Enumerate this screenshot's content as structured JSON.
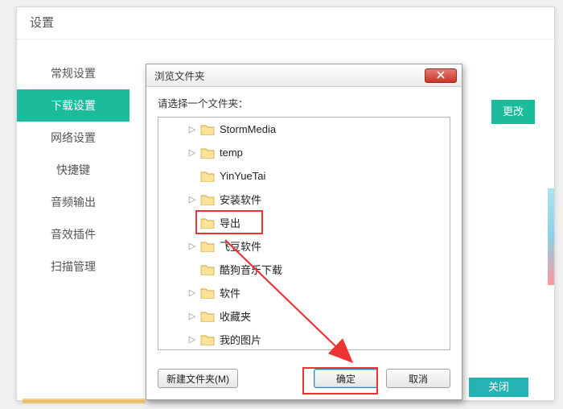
{
  "settings": {
    "title": "设置",
    "sidebar": [
      "常规设置",
      "下载设置",
      "网络设置",
      "快捷键",
      "音频输出",
      "音效插件",
      "扫描管理"
    ],
    "active_index": 1,
    "change_btn": "更改",
    "close_btn": "关闭"
  },
  "dialog": {
    "title": "浏览文件夹",
    "prompt": "请选择一个文件夹：",
    "tree": [
      {
        "label": "StormMedia",
        "expandable": true
      },
      {
        "label": "temp",
        "expandable": true
      },
      {
        "label": "YinYueTai",
        "expandable": false
      },
      {
        "label": "安装软件",
        "expandable": true
      },
      {
        "label": "导出",
        "expandable": false,
        "selected": true
      },
      {
        "label": "飞豆软件",
        "expandable": true
      },
      {
        "label": "酷狗音乐下载",
        "expandable": false
      },
      {
        "label": "软件",
        "expandable": true
      },
      {
        "label": "收藏夹",
        "expandable": true
      },
      {
        "label": "我的图片",
        "expandable": true
      }
    ],
    "new_folder_btn": "新建文件夹(M)",
    "ok_btn": "确定",
    "cancel_btn": "取消"
  }
}
